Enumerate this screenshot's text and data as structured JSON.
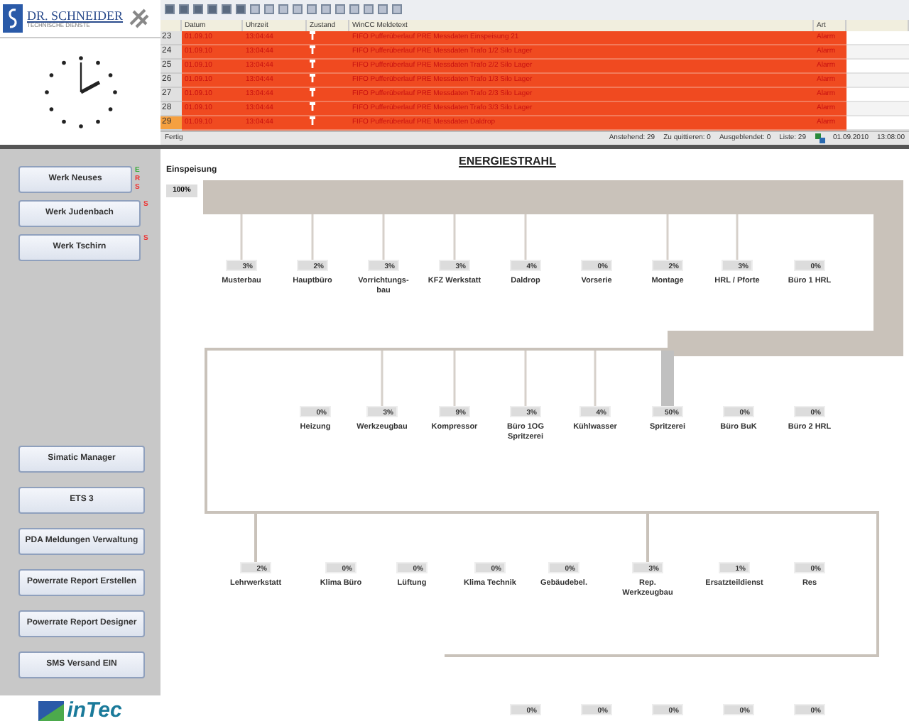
{
  "logo": {
    "name": "DR. SCHNEIDER",
    "tagline": "TECHNISCHE DIENSTE"
  },
  "alarm_table": {
    "columns": [
      "Datum",
      "Uhrzeit",
      "Zustand",
      "WinCC Meldetext",
      "Art"
    ],
    "rows": [
      {
        "number": "23",
        "date": "01.09.10",
        "time": "13:04:44",
        "text": "FIFO Pufferüberlauf PRE Messdaten Einspeisung 21",
        "type": "Alarm",
        "selected": false
      },
      {
        "number": "24",
        "date": "01.09.10",
        "time": "13:04:44",
        "text": "FIFO Pufferüberlauf PRE Messdaten Trafo 1/2 Silo Lager",
        "type": "Alarm",
        "selected": false
      },
      {
        "number": "25",
        "date": "01.09.10",
        "time": "13:04:44",
        "text": "FIFO Pufferüberlauf PRE Messdaten Trafo 2/2 Silo Lager",
        "type": "Alarm",
        "selected": false
      },
      {
        "number": "26",
        "date": "01.09.10",
        "time": "13:04:44",
        "text": "FIFO Pufferüberlauf PRE Messdaten Trafo 1/3 Silo Lager",
        "type": "Alarm",
        "selected": false
      },
      {
        "number": "27",
        "date": "01.09.10",
        "time": "13:04:44",
        "text": "FIFO Pufferüberlauf PRE Messdaten Trafo 2/3 Silo Lager",
        "type": "Alarm",
        "selected": false
      },
      {
        "number": "28",
        "date": "01.09.10",
        "time": "13:04:44",
        "text": "FIFO Pufferüberlauf PRE Messdaten Trafo 3/3 Silo Lager",
        "type": "Alarm",
        "selected": false
      },
      {
        "number": "29",
        "date": "01.09.10",
        "time": "13:04:44",
        "text": "FIFO Pufferüberlauf PRE Messdaten Daldrop",
        "type": "Alarm",
        "selected": true
      }
    ]
  },
  "status_bar": {
    "state": "Fertig",
    "counts": [
      "Anstehend: 29",
      "Zu quittieren: 0",
      "Ausgeblendet: 0",
      "Liste: 29"
    ],
    "date": "01.09.2010",
    "time": "13:08:00"
  },
  "sidebar": {
    "plants": [
      {
        "label": "Werk Neuses",
        "flags": [
          {
            "letter": "E",
            "color": "#33aa33"
          },
          {
            "letter": "R",
            "color": "#ee3333"
          },
          {
            "letter": "S",
            "color": "#ee3333"
          }
        ]
      },
      {
        "label": "Werk Judenbach",
        "flags": [
          {
            "letter": "S",
            "color": "#ee3333"
          }
        ]
      },
      {
        "label": "Werk Tschirn",
        "flags": [
          {
            "letter": "S",
            "color": "#ee3333"
          }
        ]
      }
    ],
    "tools": [
      "Simatic Manager",
      "ETS 3",
      "PDA Meldungen Verwaltung",
      "Powerrate Report Erstellen",
      "Powerrate Report Designer",
      "SMS Versand EIN"
    ],
    "brand": "inTec"
  },
  "diagram": {
    "title": "ENERGIESTRAHL",
    "feed_label": "Einspeisung",
    "feed_value": "100%",
    "branches": [
      {
        "consumers": [
          {
            "label": "Musterbau",
            "value": "3%",
            "linked": true
          },
          {
            "label": "Hauptbüro",
            "value": "2%",
            "linked": true
          },
          {
            "label": "Vorrichtungs-bau",
            "value": "3%",
            "linked": true
          },
          {
            "label": "KFZ Werkstatt",
            "value": "3%",
            "linked": true
          },
          {
            "label": "Daldrop",
            "value": "4%",
            "linked": true
          },
          {
            "label": "Vorserie",
            "value": "0%",
            "linked": false
          },
          {
            "label": "Montage",
            "value": "2%",
            "linked": true
          },
          {
            "label": "HRL / Pforte",
            "value": "3%",
            "linked": true
          },
          {
            "label": "Büro 1 HRL",
            "value": "0%",
            "linked": false
          }
        ]
      },
      {
        "consumers": [
          {
            "label": "Heizung",
            "value": "0%",
            "linked": false
          },
          {
            "label": "Werkzeugbau",
            "value": "3%",
            "linked": true
          },
          {
            "label": "Kompressor",
            "value": "9%",
            "linked": true
          },
          {
            "label": "Büro 1OG Spritzerei",
            "value": "3%",
            "linked": true
          },
          {
            "label": "Kühlwasser",
            "value": "4%",
            "linked": true
          },
          {
            "label": "Spritzerei",
            "value": "50%",
            "linked": true
          },
          {
            "label": "Büro BuK",
            "value": "0%",
            "linked": false
          },
          {
            "label": "Büro 2 HRL",
            "value": "0%",
            "linked": false
          }
        ]
      },
      {
        "consumers": [
          {
            "label": "Lehrwerkstatt",
            "value": "2%",
            "linked": true
          },
          {
            "label": "Klima Büro",
            "value": "0%",
            "linked": false
          },
          {
            "label": "Lüftung",
            "value": "0%",
            "linked": false
          },
          {
            "label": "Klima Technik",
            "value": "0%",
            "linked": false
          },
          {
            "label": "Gebäudebel.",
            "value": "0%",
            "linked": false
          },
          {
            "label": "Rep. Werkzeugbau",
            "value": "3%",
            "linked": true
          },
          {
            "label": "Ersatzteildienst",
            "value": "1%",
            "linked": false
          },
          {
            "label": "Res",
            "value": "0%",
            "linked": false
          }
        ]
      },
      {
        "consumers": [
          {
            "value": "0%"
          },
          {
            "value": "0%"
          },
          {
            "value": "0%"
          },
          {
            "value": "0%"
          },
          {
            "value": "0%"
          }
        ]
      }
    ]
  }
}
